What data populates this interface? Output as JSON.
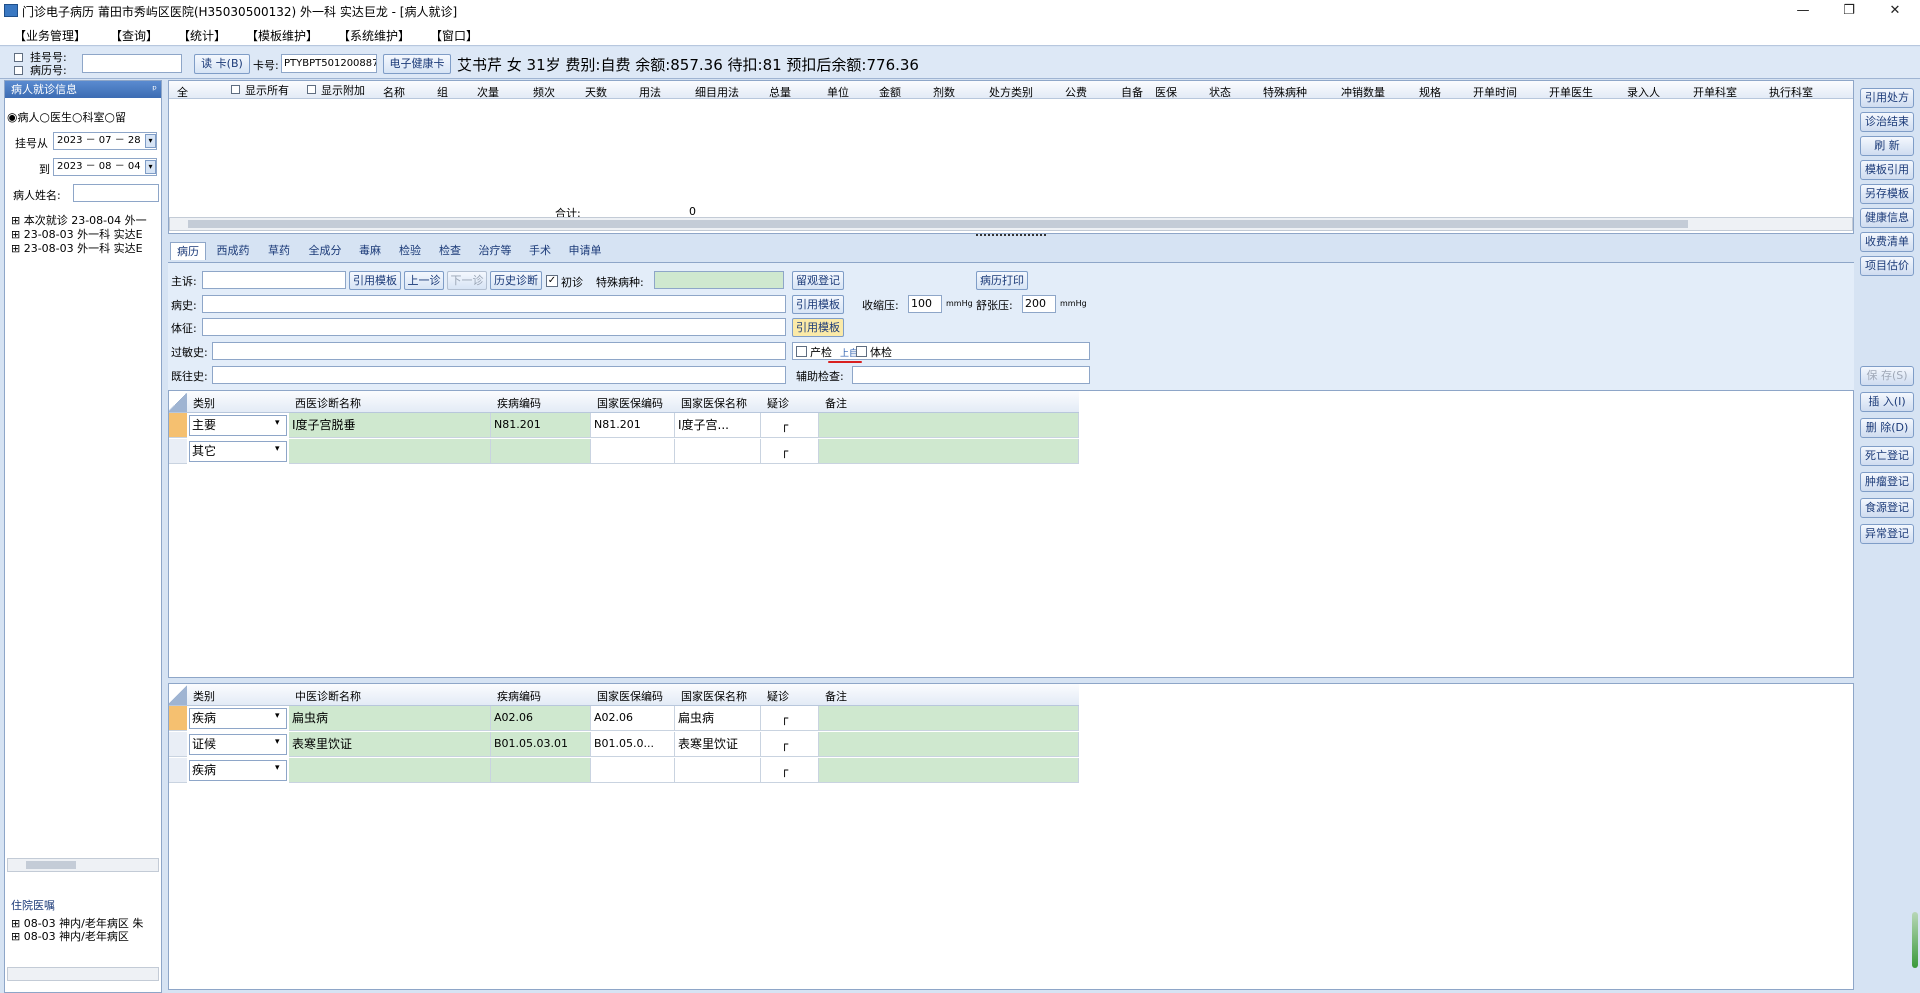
{
  "window": {
    "title": "门诊电子病历  莆田市秀屿区医院(H35030500132)  外一科  实达巨龙 - [病人就诊]",
    "min": "—",
    "restore": "❐",
    "close": "✕"
  },
  "menu": [
    "【业务管理】",
    "【查询】",
    "【统计】",
    "【模板维护】",
    "【系统维护】",
    "【窗口】"
  ],
  "patient_bar": {
    "reg_no_label": "挂号号:",
    "record_no_label": "病历号:",
    "read_card": "读 卡(B)",
    "card_label": "卡号:",
    "card_no": "PTYBPT501200887!",
    "health_card": "电子健康卡",
    "info": "艾书芹 女 31岁 费别:自费 余额:857.36 待扣:81 预扣后余额:776.36"
  },
  "left": {
    "header": "病人就诊信息",
    "pin": "ᵖ",
    "radios": [
      "病人",
      "医生",
      "科室",
      "留"
    ],
    "from_label": "挂号从",
    "from": "2023 － 07 － 28",
    "to_label": "到",
    "to": "2023 － 08 － 04",
    "name_label": "病人姓名:",
    "tree": [
      "本次就诊  23-08-04  外一",
      "23-08-03  外一科  实达E",
      "23-08-03  外一科  实达E"
    ],
    "inpatient_header": "住院医嘱",
    "inpatient_items": [
      "08-03  神内/老年病区  朱",
      "08-03  神内/老年病区"
    ]
  },
  "rx_grid": {
    "headers": [
      "全",
      "显示所有",
      "显示附加",
      "名称",
      "组",
      "次量",
      "频次",
      "天数",
      "用法",
      "细目用法",
      "总量",
      "单位",
      "金额",
      "剂数",
      "处方类别",
      "公费",
      "自备",
      "医保",
      "状态",
      "特殊病种",
      "冲销数量",
      "规格",
      "开单时间",
      "开单医生",
      "录入人",
      "开单科室",
      "执行科室"
    ],
    "total_label": "合计:",
    "total_value": "0"
  },
  "tabs": [
    "病历",
    "西成药",
    "草药",
    "全成分",
    "毒麻",
    "检验",
    "检查",
    "治疗等",
    "手术",
    "申请单"
  ],
  "form": {
    "complaint": "主诉:",
    "cite_template": "引用模板",
    "prev": "上一诊",
    "next": "下一诊",
    "history_diag": "历史诊断",
    "first_visit": "初诊",
    "special_disease": "特殊病种:",
    "observe_reg": "留观登记",
    "record_print": "病历打印",
    "history": "病史:",
    "systolic": "收缩压:",
    "systolic_val": "100",
    "unit1": "mmHg",
    "diastolic": "舒张压:",
    "diastolic_val": "200",
    "unit2": "mmHg",
    "signs": "体征:",
    "allergy": "过敏史:",
    "prenatal": "产检",
    "prenatal_extra": "上自",
    "physical": "体检",
    "past": "既往史:",
    "aux_exam": "辅助检查:"
  },
  "wdiag": {
    "headers": [
      "类别",
      "西医诊断名称",
      "疾病编码",
      "国家医保编码",
      "国家医保名称",
      "疑诊",
      "备注"
    ],
    "rows": [
      {
        "type": "主要",
        "name": "Ⅰ度子宫脱垂",
        "code": "N81.201",
        "ncode": "N81.201",
        "nname": "Ⅰ度子宫...",
        "doubt": "┌",
        "note": ""
      },
      {
        "type": "其它",
        "name": "",
        "code": "",
        "ncode": "",
        "nname": "",
        "doubt": "┌",
        "note": ""
      }
    ]
  },
  "cdiag": {
    "headers": [
      "类别",
      "中医诊断名称",
      "疾病编码",
      "国家医保编码",
      "国家医保名称",
      "疑诊",
      "备注"
    ],
    "rows": [
      {
        "type": "疾病",
        "name": "扁虫病",
        "code": "A02.06",
        "ncode": "A02.06",
        "nname": "扁虫病",
        "doubt": "┌",
        "note": ""
      },
      {
        "type": "证候",
        "name": "表寒里饮证",
        "code": "B01.05.03.01",
        "ncode": "B01.05.0...",
        "nname": "表寒里饮证",
        "doubt": "┌",
        "note": ""
      },
      {
        "type": "疾病",
        "name": "",
        "code": "",
        "ncode": "",
        "nname": "",
        "doubt": "┌",
        "note": ""
      }
    ]
  },
  "right_buttons": [
    "引用处方",
    "诊治结束",
    "刷 新",
    "模板引用",
    "另存模板",
    "健康信息",
    "收费清单",
    "项目估价"
  ],
  "right_buttons2": [
    "保 存(S)",
    "插 入(I)",
    "删 除(D)",
    "死亡登记",
    "肿瘤登记",
    "食源登记",
    "异常登记"
  ],
  "colors": {
    "green": "#cfe8cf",
    "accent": "#3c6cb3"
  }
}
